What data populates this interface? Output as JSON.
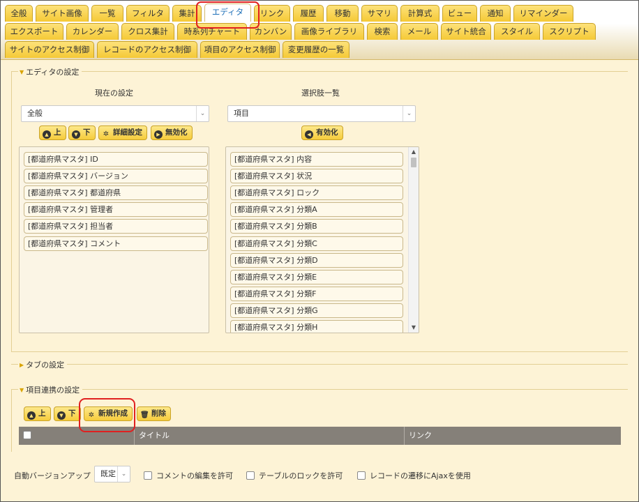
{
  "tabs": {
    "row1": [
      "全般",
      "サイト画像",
      "一覧",
      "フィルタ",
      "集計",
      "エディタ",
      "リンク",
      "履歴",
      "移動",
      "サマリ",
      "計算式",
      "ビュー",
      "通知",
      "リマインダー"
    ],
    "row2": [
      "エクスポート",
      "カレンダー",
      "クロス集計",
      "時系列チャート",
      "カンバン",
      "画像ライブラリ",
      "検索",
      "メール",
      "サイト統合",
      "スタイル",
      "スクリプト"
    ],
    "row3": [
      "サイトのアクセス制御",
      "レコードのアクセス制御",
      "項目のアクセス制御",
      "変更履歴の一覧"
    ],
    "active": "エディタ"
  },
  "editor": {
    "legend": "エディタの設定",
    "current": {
      "heading": "現在の設定",
      "select_value": "全般",
      "buttons": {
        "up": "上",
        "down": "下",
        "detail": "詳細設定",
        "disable": "無効化"
      },
      "items": [
        "[都道府県マスタ] ID",
        "[都道府県マスタ] バージョン",
        "[都道府県マスタ] 都道府県",
        "[都道府県マスタ] 管理者",
        "[都道府県マスタ] 担当者",
        "[都道府県マスタ] コメント"
      ]
    },
    "options": {
      "heading": "選択肢一覧",
      "select_value": "項目",
      "buttons": {
        "enable": "有効化"
      },
      "items": [
        "[都道府県マスタ] 内容",
        "[都道府県マスタ] 状況",
        "[都道府県マスタ] ロック",
        "[都道府県マスタ] 分類A",
        "[都道府県マスタ] 分類B",
        "[都道府県マスタ] 分類C",
        "[都道府県マスタ] 分類D",
        "[都道府県マスタ] 分類E",
        "[都道府県マスタ] 分類F",
        "[都道府県マスタ] 分類G",
        "[都道府県マスタ] 分類H"
      ]
    }
  },
  "tab_settings": {
    "legend": "タブの設定"
  },
  "linking": {
    "legend": "項目連携の設定",
    "buttons": {
      "up": "上",
      "down": "下",
      "new": "新規作成",
      "delete": "削除"
    },
    "columns": [
      "タイトル",
      "リンク"
    ]
  },
  "footer": {
    "auto_version_label": "自動バージョンアップ",
    "auto_version_value": "既定",
    "checkboxes": [
      "コメントの編集を許可",
      "テーブルのロックを許可",
      "レコードの遷移にAjaxを使用"
    ]
  },
  "icons": {
    "up": "chevron-up-icon",
    "down": "chevron-down-icon",
    "gear": "gear-icon",
    "disable": "chevron-right-icon",
    "enable": "chevron-left-icon",
    "trash": "trash-icon",
    "caret": "caret-down-icon",
    "expand": "caret-right-icon"
  },
  "colors": {
    "tab": "#f5c936",
    "active_tab_text": "#1d6fb8",
    "background": "#fdf3d6",
    "highlight": "#e02020",
    "table_header": "#858079"
  }
}
